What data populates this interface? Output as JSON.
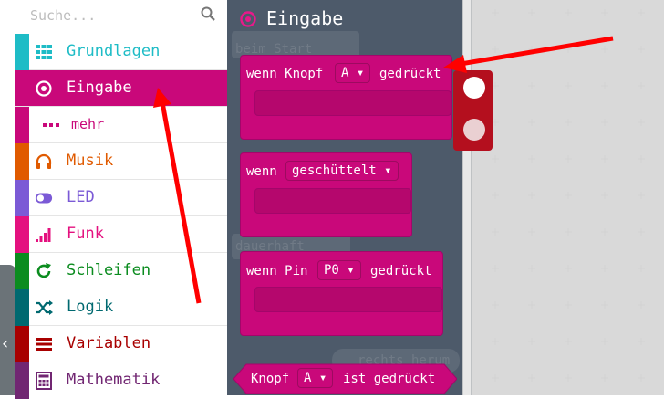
{
  "search": {
    "placeholder": "Suche..."
  },
  "categories": [
    {
      "label": "Grundlagen",
      "color": "#1ebcc6",
      "icon": "grid-icon"
    },
    {
      "label": "Eingabe",
      "color": "#c9087a",
      "icon": "radio-target-icon",
      "active": true
    },
    {
      "label": "mehr",
      "color": "#c9087a",
      "icon": "more-dots-icon",
      "sub": true
    },
    {
      "label": "Musik",
      "color": "#e05a00",
      "icon": "headphones-icon"
    },
    {
      "label": "LED",
      "color": "#7b5ad6",
      "icon": "toggle-icon"
    },
    {
      "label": "Funk",
      "color": "#e4117f",
      "icon": "signal-bars-icon"
    },
    {
      "label": "Schleifen",
      "color": "#0b8c1f",
      "icon": "refresh-icon"
    },
    {
      "label": "Logik",
      "color": "#006970",
      "icon": "shuffle-icon"
    },
    {
      "label": "Variablen",
      "color": "#a80000",
      "icon": "lines-icon"
    },
    {
      "label": "Mathematik",
      "color": "#712672",
      "icon": "calculator-icon"
    }
  ],
  "flyout": {
    "title": "Eingabe",
    "ghost_texts": [
      "beim Start",
      "dauerhaft",
      "rechts herum"
    ],
    "blocks": [
      {
        "prefix": "wenn Knopf",
        "dropdown": "A",
        "suffix": "gedrückt"
      },
      {
        "prefix": "wenn",
        "dropdown": "geschüttelt",
        "suffix": ""
      },
      {
        "prefix": "wenn Pin",
        "dropdown": "P0",
        "suffix": "gedrückt"
      },
      {
        "prefix": "Knopf",
        "dropdown": "A",
        "suffix": "ist gedrückt"
      }
    ]
  },
  "colors": {
    "accent": "#c9087a",
    "flyout_bg": "#4d5a6a",
    "annotation": "#ff0000"
  }
}
